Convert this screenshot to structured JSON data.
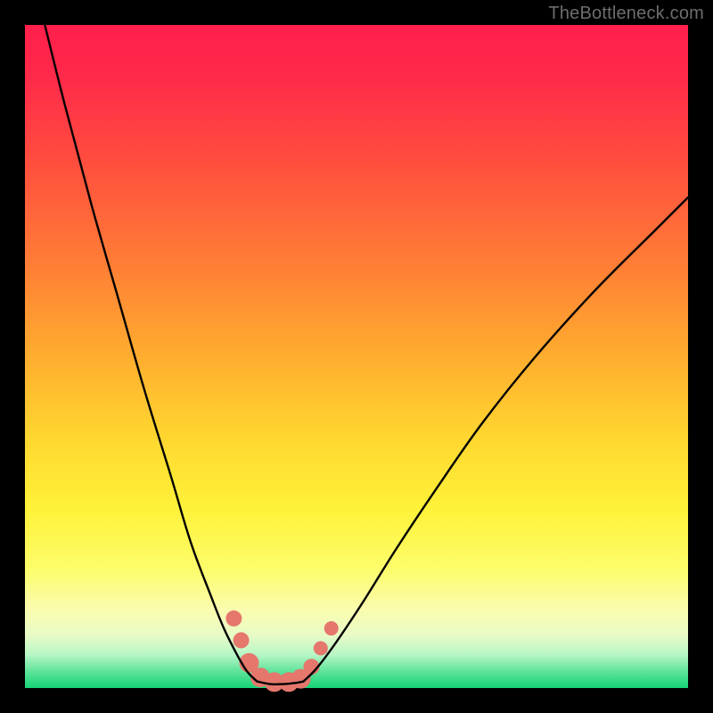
{
  "watermark": "TheBottleneck.com",
  "chart_data": {
    "type": "line",
    "title": "",
    "xlabel": "",
    "ylabel": "",
    "xlim": [
      0,
      100
    ],
    "ylim": [
      0,
      100
    ],
    "grid": false,
    "legend": false,
    "series": [
      {
        "name": "left-branch",
        "x": [
          3,
          6,
          10,
          14,
          18,
          22,
          25,
          28,
          30,
          32,
          33.5,
          35
        ],
        "y": [
          100,
          88,
          73,
          59,
          45,
          32,
          22,
          14,
          9,
          5,
          2.5,
          1
        ]
      },
      {
        "name": "right-branch",
        "x": [
          42,
          44,
          47,
          51,
          56,
          62,
          69,
          77,
          86,
          95,
          100
        ],
        "y": [
          1,
          3,
          7,
          13,
          21,
          30,
          40,
          50,
          60,
          69,
          74
        ]
      },
      {
        "name": "flat-bottom",
        "x": [
          35,
          37,
          39,
          41,
          42
        ],
        "y": [
          1,
          0.6,
          0.6,
          0.8,
          1
        ]
      }
    ],
    "markers": {
      "name": "highlight-dots",
      "color": "#e5776d",
      "points": [
        {
          "x": 31.5,
          "y": 10.5,
          "r": 9
        },
        {
          "x": 32.6,
          "y": 7.2,
          "r": 9
        },
        {
          "x": 33.8,
          "y": 3.8,
          "r": 11
        },
        {
          "x": 35.5,
          "y": 1.6,
          "r": 11
        },
        {
          "x": 37.6,
          "y": 0.9,
          "r": 11
        },
        {
          "x": 39.8,
          "y": 0.9,
          "r": 11
        },
        {
          "x": 41.6,
          "y": 1.4,
          "r": 11
        },
        {
          "x": 43.2,
          "y": 3.2,
          "r": 9
        },
        {
          "x": 44.6,
          "y": 6.0,
          "r": 8
        },
        {
          "x": 46.2,
          "y": 9.0,
          "r": 8
        }
      ]
    }
  }
}
